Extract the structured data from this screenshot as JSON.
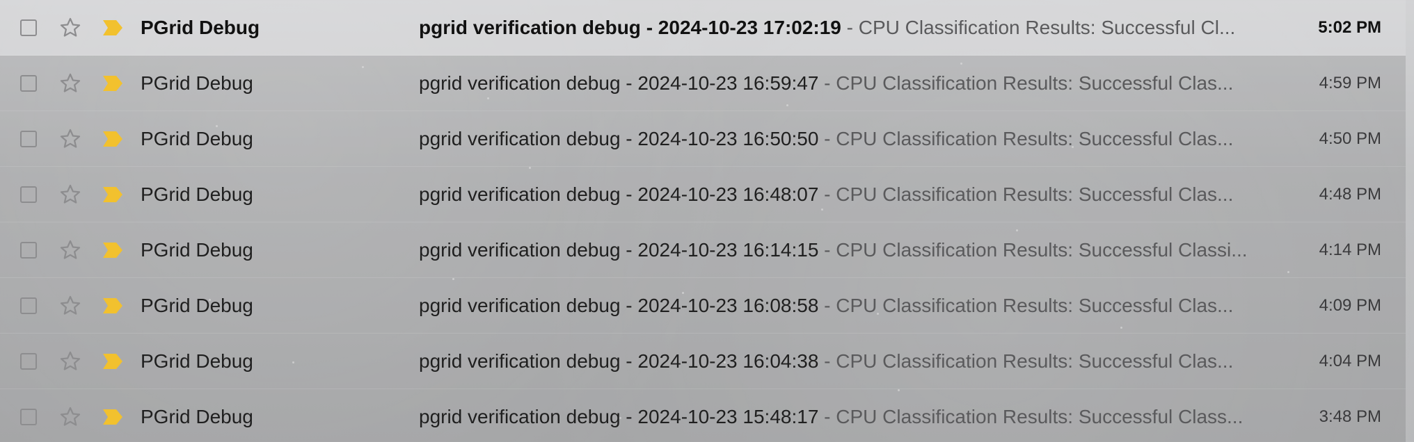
{
  "colors": {
    "importance_marker": "#f2c12e",
    "star_outline": "#8d8d8f"
  },
  "icons": {
    "checkbox": "checkbox-icon",
    "star": "star-outline-icon",
    "importance": "importance-marker-icon"
  },
  "emails": [
    {
      "sender": "PGrid Debug",
      "subject": "pgrid verification debug - 2024-10-23 17:02:19",
      "snippet": " - CPU Classification Results: Successful Cl...",
      "time": "5:02 PM",
      "unread": true
    },
    {
      "sender": "PGrid Debug",
      "subject": "pgrid verification debug - 2024-10-23 16:59:47",
      "snippet": " - CPU Classification Results: Successful Clas...",
      "time": "4:59 PM",
      "unread": false
    },
    {
      "sender": "PGrid Debug",
      "subject": "pgrid verification debug - 2024-10-23 16:50:50",
      "snippet": " - CPU Classification Results: Successful Clas...",
      "time": "4:50 PM",
      "unread": false
    },
    {
      "sender": "PGrid Debug",
      "subject": "pgrid verification debug - 2024-10-23 16:48:07",
      "snippet": " - CPU Classification Results: Successful Clas...",
      "time": "4:48 PM",
      "unread": false
    },
    {
      "sender": "PGrid Debug",
      "subject": "pgrid verification debug - 2024-10-23 16:14:15",
      "snippet": " - CPU Classification Results: Successful Classi...",
      "time": "4:14 PM",
      "unread": false
    },
    {
      "sender": "PGrid Debug",
      "subject": "pgrid verification debug - 2024-10-23 16:08:58",
      "snippet": " - CPU Classification Results: Successful Clas...",
      "time": "4:09 PM",
      "unread": false
    },
    {
      "sender": "PGrid Debug",
      "subject": "pgrid verification debug - 2024-10-23 16:04:38",
      "snippet": " - CPU Classification Results: Successful Clas...",
      "time": "4:04 PM",
      "unread": false
    },
    {
      "sender": "PGrid Debug",
      "subject": "pgrid verification debug - 2024-10-23 15:48:17",
      "snippet": " - CPU Classification Results: Successful Class...",
      "time": "3:48 PM",
      "unread": false
    }
  ]
}
